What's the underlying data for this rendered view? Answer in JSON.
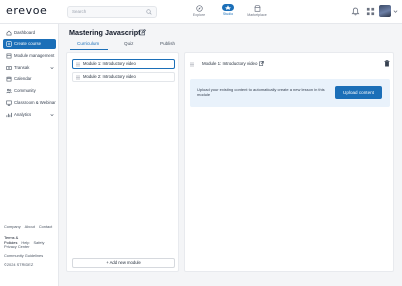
{
  "brand": {
    "logo_text": "erevoe"
  },
  "search": {
    "placeholder": "Search"
  },
  "topnav": {
    "items": [
      {
        "label": "Explore",
        "icon": "compass-icon"
      },
      {
        "label": "Studio",
        "icon": "studio-icon",
        "active": true
      },
      {
        "label": "Marketplace",
        "icon": "marketplace-icon"
      }
    ],
    "accent": "#1b6fb8"
  },
  "sidebar": {
    "items": [
      {
        "label": "Dashboard",
        "icon": "dashboard-icon"
      },
      {
        "label": "Create course",
        "icon": "plus-icon",
        "active": true
      },
      {
        "label": "Module management",
        "icon": "module-icon"
      },
      {
        "label": "Transak",
        "icon": "money-icon",
        "has_chevron": true
      },
      {
        "label": "Calendar",
        "icon": "calendar-icon"
      },
      {
        "label": "Community",
        "icon": "community-icon"
      },
      {
        "label": "Classroom & Webinar",
        "icon": "classroom-icon"
      },
      {
        "label": "Analytics",
        "icon": "analytics-icon",
        "has_chevron": true
      }
    ],
    "footer": {
      "row1": [
        "Company",
        "About",
        "Contact"
      ],
      "row2": [
        "Terms & Policies",
        "Help",
        "Safety"
      ],
      "privacy": "Privacy Center",
      "guidelines": "Community Guidelines",
      "copyright": "©2024 STRIDEZ"
    }
  },
  "page": {
    "title": "Mastering Javascript",
    "tabs": [
      "Curriculum",
      "Quiz",
      "Publish"
    ],
    "active_tab": "Curriculum"
  },
  "modules": [
    {
      "label": "Module 1: Introductory video",
      "selected": true
    },
    {
      "label": "Module 2: Introductory video",
      "selected": false
    }
  ],
  "add_module_label": "Add new module",
  "add_module_prefix": "+",
  "detail": {
    "title": "Module 1: Introductory video",
    "upload_text": "Upload your existing content to automatically create a new lesson in this module",
    "upload_button": "Upload content"
  }
}
